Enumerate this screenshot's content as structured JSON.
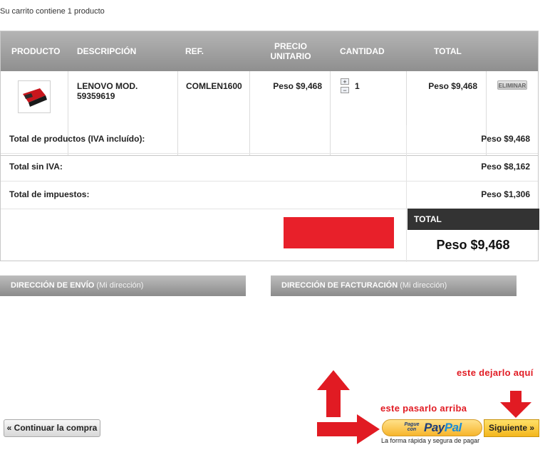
{
  "cart_summary": "Su carrito contiene 1 producto",
  "table": {
    "headers": {
      "product": "PRODUCTO",
      "description": "DESCRIPCIÓN",
      "ref": "REF.",
      "unit_price": "PRECIO UNITARIO",
      "quantity": "CANTIDAD",
      "total": "TOTAL"
    },
    "item": {
      "description": "LENOVO MOD. 59359619",
      "ref": "COMLEN1600",
      "unit_price": "Peso $9,468",
      "quantity": "1",
      "total": "Peso $9,468",
      "delete_label": "ELIMINAR",
      "qty_plus": "+",
      "qty_minus": "−"
    }
  },
  "summary": {
    "products_label": "Total de productos (IVA incluído):",
    "products_value": "Peso $9,468",
    "no_tax_label": "Total sin IVA:",
    "no_tax_value": "Peso $8,162",
    "taxes_label": "Total de impuestos:",
    "taxes_value": "Peso $1,306",
    "total_label": "TOTAL",
    "total_value": "Peso $9,468"
  },
  "addresses": {
    "shipping_title": "DIRECCIÓN DE ENVÍO",
    "shipping_sub": "(Mi dirección)",
    "billing_title": "DIRECCIÓN DE FACTURACIÓN",
    "billing_sub": "(Mi dirección)"
  },
  "buttons": {
    "continue": "« Continuar la compra",
    "paypal_small": "Pague con",
    "paypal_logo_a": "Pay",
    "paypal_logo_b": "Pal",
    "paypal_tagline": "La forma rápida y segura de pagar",
    "next": "Siguiente »"
  },
  "annotations": {
    "move_up": "este pasarlo arriba",
    "keep_here": "este dejarlo aquí"
  },
  "colors": {
    "annotation_red": "#e11b23",
    "header_gray": "#9a9a9a",
    "total_dark": "#333333",
    "next_yellow": "#f3b61d"
  }
}
